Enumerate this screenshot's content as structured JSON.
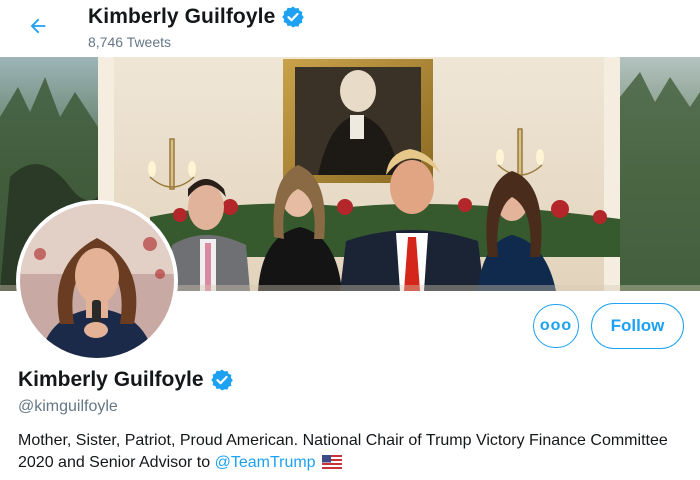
{
  "header": {
    "name": "Kimberly Guilfoyle",
    "tweet_count": "8,746 Tweets",
    "back_icon": "arrow-left-icon",
    "verified_icon": "verified-badge-icon"
  },
  "actions": {
    "more_label": "ooo",
    "follow_label": "Follow"
  },
  "profile": {
    "name": "Kimberly Guilfoyle",
    "handle": "@kimguilfoyle",
    "bio_text": "Mother, Sister, Patriot, Proud American. National Chair of Trump Victory Finance Committee 2020 and Senior Advisor to ",
    "bio_mention": "@TeamTrump",
    "bio_flag_icon": "us-flag-icon"
  },
  "colors": {
    "accent": "#1da1f2",
    "secondary_text": "#657786",
    "primary_text": "#14171a"
  }
}
